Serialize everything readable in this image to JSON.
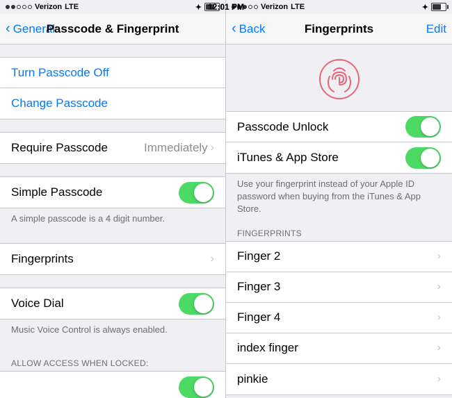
{
  "left_panel": {
    "status": {
      "carrier": "Verizon",
      "network": "LTE",
      "time": "12:01 PM",
      "bluetooth": "✦"
    },
    "nav": {
      "back_label": "General",
      "title": "Passcode & Fingerprint"
    },
    "actions": [
      {
        "id": "turn-off",
        "label": "Turn Passcode Off"
      },
      {
        "id": "change",
        "label": "Change Passcode"
      }
    ],
    "require_passcode": {
      "label": "Require Passcode",
      "value": "Immediately"
    },
    "simple_passcode": {
      "label": "Simple Passcode",
      "on": true
    },
    "simple_passcode_helper": "A simple passcode is a 4 digit number.",
    "fingerprints": {
      "label": "Fingerprints"
    },
    "voice_dial": {
      "label": "Voice Dial",
      "on": true
    },
    "voice_dial_helper": "Music Voice Control is always enabled.",
    "allow_label": "ALLOW ACCESS WHEN LOCKED:"
  },
  "right_panel": {
    "status": {
      "carrier": "Verizon",
      "network": "LTE",
      "time": "12:01 PM",
      "bluetooth": "✦"
    },
    "nav": {
      "back_label": "Back",
      "title": "Fingerprints",
      "right_label": "Edit"
    },
    "passcode_unlock": {
      "label": "Passcode Unlock",
      "on": true
    },
    "itunes_store": {
      "label": "iTunes & App Store",
      "on": true
    },
    "info_text": "Use your fingerprint instead of your Apple ID password when buying from the iTunes & App Store.",
    "fingerprints_section_label": "FINGERPRINTS",
    "fingers": [
      "Finger 2",
      "Finger 3",
      "Finger 4",
      "index finger",
      "pinkie"
    ]
  }
}
